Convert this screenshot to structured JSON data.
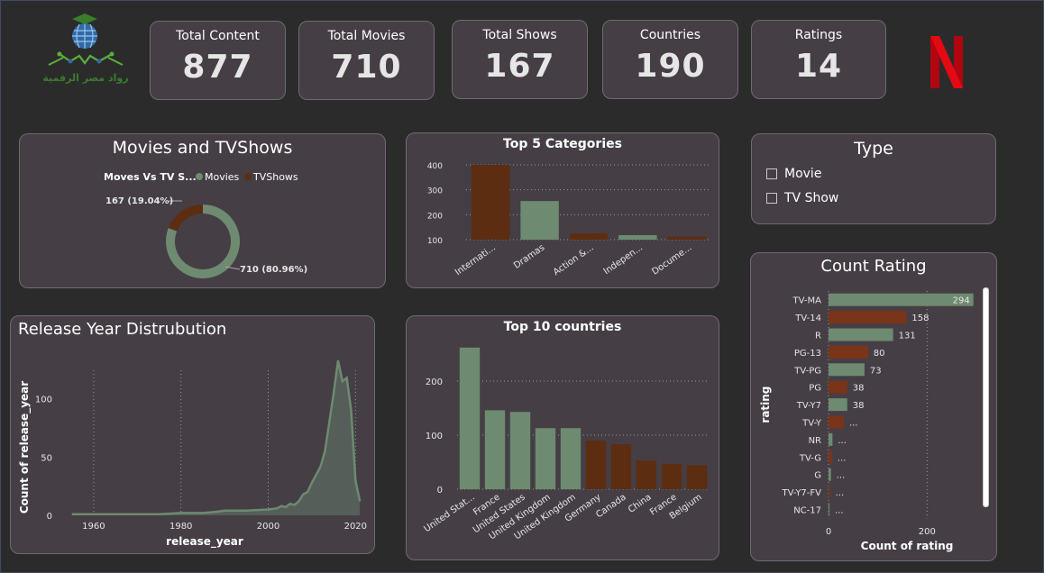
{
  "kpis": [
    {
      "label": "Total Content",
      "value": "877"
    },
    {
      "label": "Total Movies",
      "value": "710"
    },
    {
      "label": "Total Shows",
      "value": "167"
    },
    {
      "label": "Countries",
      "value": "190"
    },
    {
      "label": "Ratings",
      "value": "14"
    }
  ],
  "logo": {
    "text": "رواد مصر الرقمية"
  },
  "colors": {
    "green": "#6e8a70",
    "brown": "#5c2d10",
    "rust": "#7a3417",
    "netflix": "#e50914"
  },
  "donut": {
    "title": "Movies and TVShows",
    "legend_title": "Moves Vs TV S...",
    "legend": [
      "Movies",
      "TVShows"
    ],
    "label_shows": "167 (19.04%)",
    "label_movies": "710 (80.96%)"
  },
  "type_slicer": {
    "title": "Type",
    "options": [
      "Movie",
      "TV Show"
    ]
  },
  "chart_data": [
    {
      "type": "pie",
      "title": "Movies and TVShows",
      "categories": [
        "Movies",
        "TVShows"
      ],
      "values": [
        710,
        167
      ],
      "percent": [
        80.96,
        19.04
      ]
    },
    {
      "type": "bar",
      "title": "Top 5 Categories",
      "categories": [
        "Internati...",
        "Dramas",
        "Action &...",
        "Indepen...",
        "Docume..."
      ],
      "values": [
        400,
        255,
        125,
        118,
        112
      ],
      "yticks": [
        100,
        200,
        300,
        400
      ],
      "ylim": [
        100,
        400
      ]
    },
    {
      "type": "bar",
      "title": "Top 10 countries",
      "categories": [
        "United Stat...",
        "France",
        "United States",
        "United Kingdom",
        "United Kingdom",
        "Germany",
        "Canada",
        "China",
        "France",
        "Belgium"
      ],
      "values": [
        262,
        146,
        143,
        113,
        113,
        90,
        83,
        53,
        47,
        44
      ],
      "yticks": [
        0,
        100,
        200
      ],
      "ylim": [
        0,
        270
      ]
    },
    {
      "type": "area",
      "title": "Release Year Distrubution",
      "xlabel": "release_year",
      "ylabel": "Count of release_year",
      "xticks": [
        1960,
        1980,
        2000,
        2020
      ],
      "yticks": [
        0,
        50,
        100
      ],
      "xlim": [
        1953,
        2022
      ],
      "ylim": [
        0,
        140
      ],
      "x": [
        1955,
        1960,
        1965,
        1970,
        1975,
        1980,
        1985,
        1988,
        1990,
        1995,
        2000,
        2002,
        2003,
        2004,
        2005,
        2006,
        2007,
        2008,
        2009,
        2010,
        2011,
        2012,
        2013,
        2014,
        2015,
        2016,
        2017,
        2018,
        2019,
        2020,
        2021
      ],
      "y": [
        1,
        1,
        1,
        1,
        1,
        2,
        2,
        3,
        4,
        4,
        5,
        6,
        8,
        7,
        10,
        9,
        12,
        18,
        20,
        28,
        35,
        42,
        55,
        80,
        105,
        133,
        115,
        118,
        90,
        30,
        12
      ]
    },
    {
      "type": "bar",
      "orientation": "horizontal",
      "title": "Count Rating",
      "xlabel": "Count of rating",
      "ylabel": "rating",
      "xticks": [
        0,
        200
      ],
      "xlim": [
        0,
        300
      ],
      "categories": [
        "TV-MA",
        "TV-14",
        "R",
        "PG-13",
        "TV-PG",
        "PG",
        "TV-Y7",
        "TV-Y",
        "NR",
        "TV-G",
        "G",
        "TV-Y7-FV",
        "NC-17"
      ],
      "values": [
        294,
        158,
        131,
        80,
        73,
        38,
        38,
        31,
        8,
        7,
        5,
        3,
        2
      ],
      "labels": [
        "294",
        "158",
        "131",
        "80",
        "73",
        "38",
        "38",
        "...",
        "...",
        "...",
        "...",
        "...",
        "..."
      ]
    }
  ]
}
